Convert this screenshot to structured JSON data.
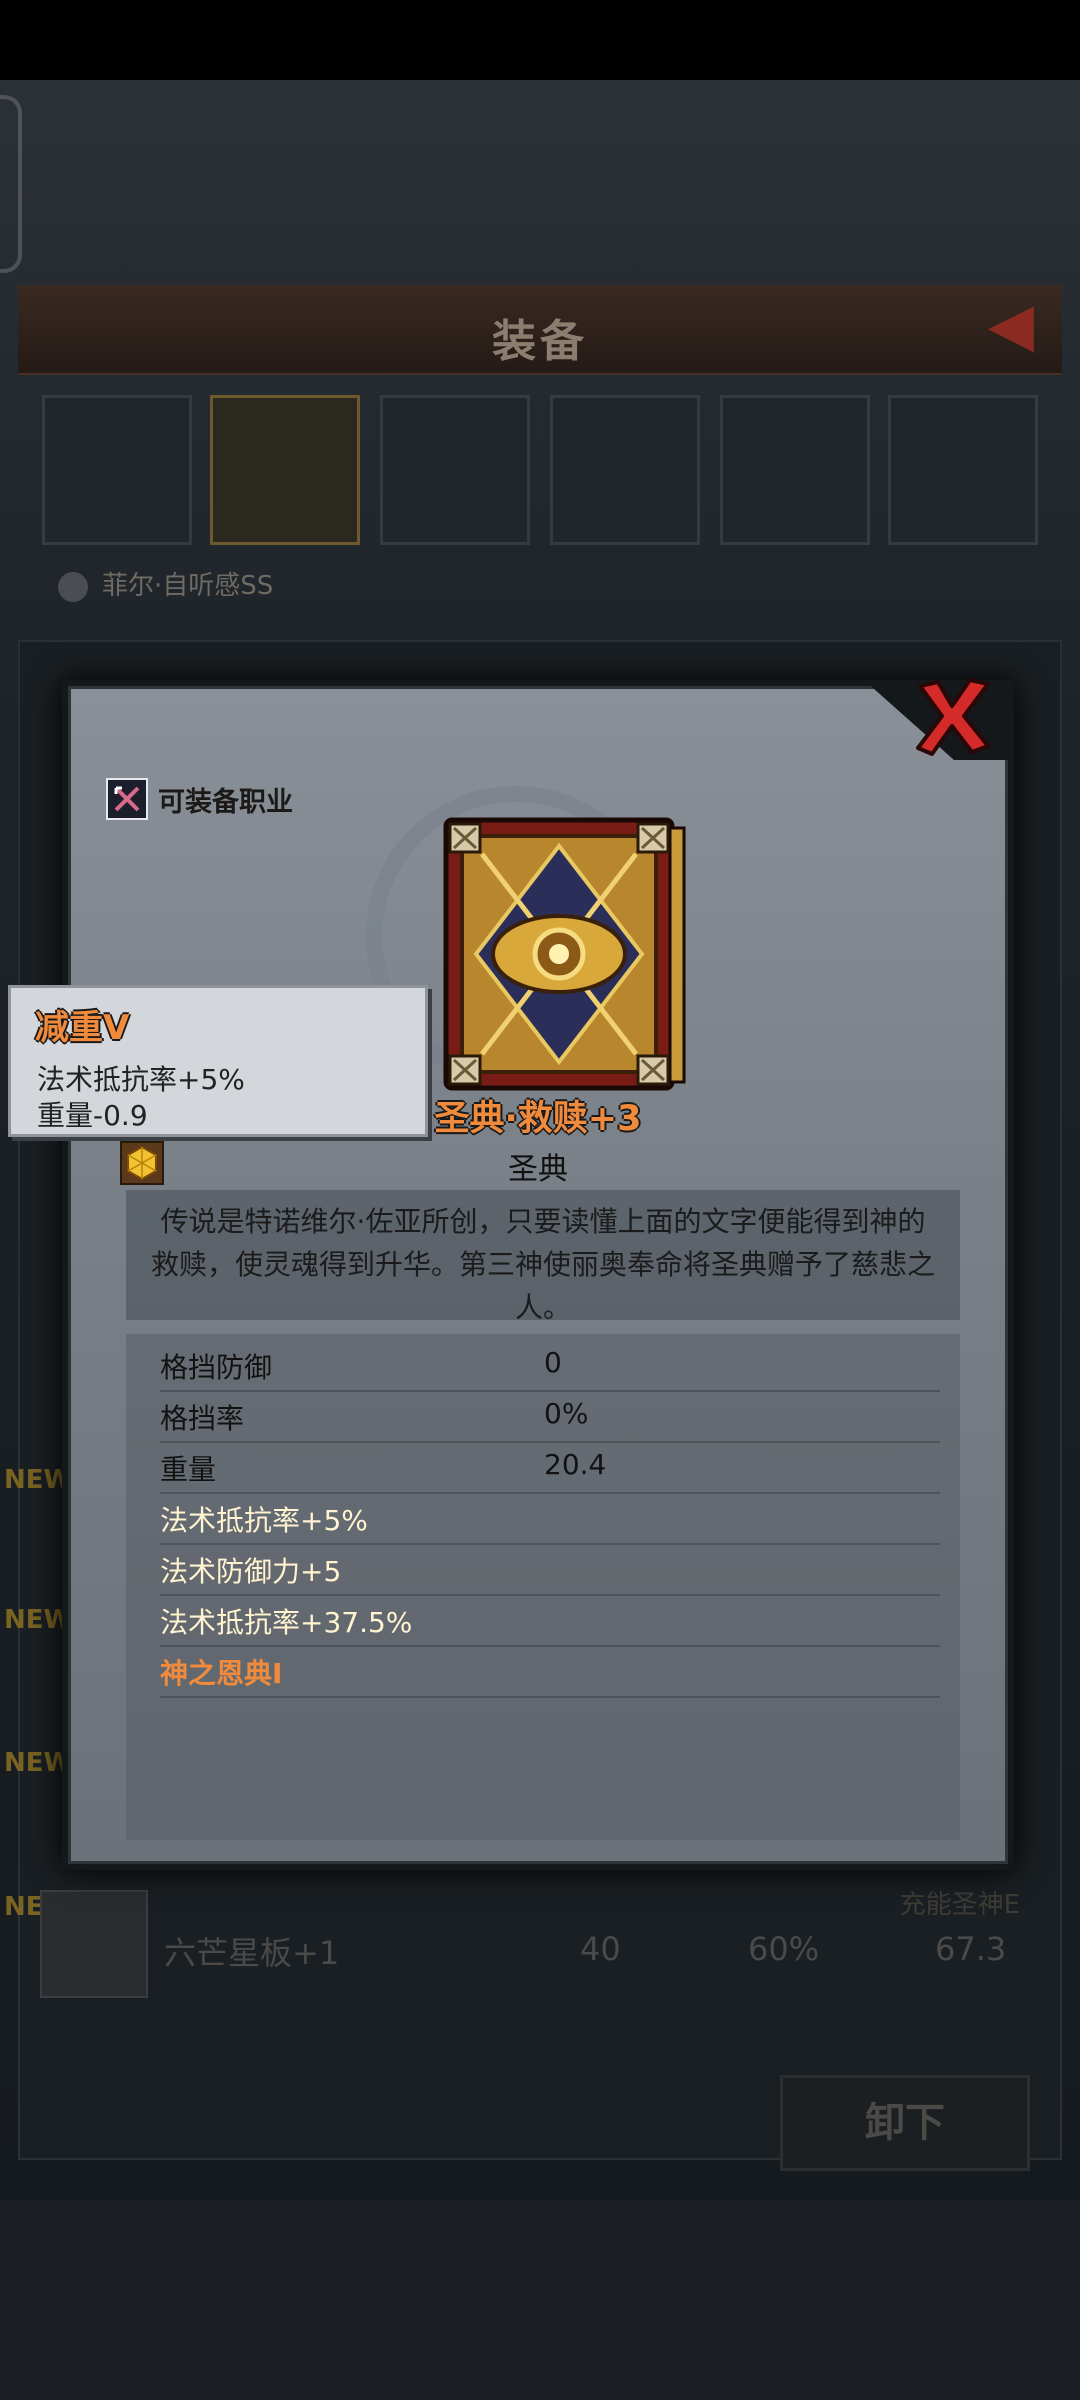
{
  "background": {
    "title": "装备",
    "hero_name": "菲尔·自听感SS",
    "new_tag": "NEW",
    "row": {
      "name": "六芒星板+1",
      "v1": "40",
      "v2": "60%",
      "v3": "67.3",
      "header": "充能圣神E"
    },
    "unequip_label": "卸下"
  },
  "popup": {
    "close_icon": "close-x-icon",
    "equip_class_label": "可装备职业",
    "item_name": "圣典·救赎+3",
    "item_type": "圣典",
    "description": "传说是特诺维尔·佐亚所创，只要读懂上面的文字便能得到神的救赎，使灵魂得到升华。第三神使丽奥奉命将圣典赠予了慈悲之人。",
    "stats": [
      {
        "label": "格挡防御",
        "value": "0"
      },
      {
        "label": "格挡率",
        "value": "0%"
      },
      {
        "label": "重量",
        "value": "20.4"
      }
    ],
    "bonuses": [
      "法术抵抗率+5%",
      "法术防御力+5",
      "法术抵抗率+37.5%"
    ],
    "special": "神之恩典I"
  },
  "tooltip": {
    "title": "减重V",
    "line1": "法术抵抗率+5%",
    "line2": "重量-0.9"
  },
  "colors": {
    "accent_orange": "#f08a3c",
    "close_red": "#d42a2a",
    "popup_bg": "#7b8189"
  }
}
